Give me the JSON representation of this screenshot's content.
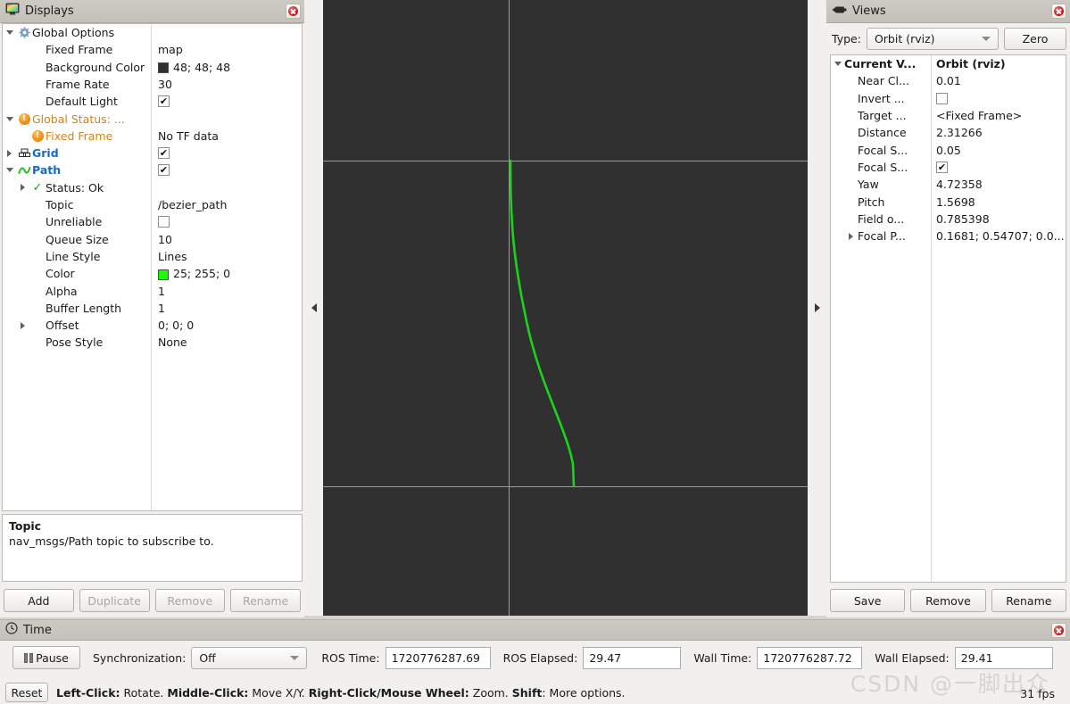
{
  "displays": {
    "title": "Displays",
    "icon": "monitor-icon",
    "close_icon": "close-icon",
    "tree": [
      {
        "indent": 0,
        "arrow": "down",
        "icon": "gear-icon",
        "label": "Global Options",
        "style": "plain",
        "value": "",
        "value_type": "none"
      },
      {
        "indent": 1,
        "arrow": "none",
        "icon": "none",
        "label": "Fixed Frame",
        "style": "plain",
        "value": "map",
        "value_type": "text"
      },
      {
        "indent": 1,
        "arrow": "none",
        "icon": "none",
        "label": "Background Color",
        "style": "plain",
        "value": "48; 48; 48",
        "value_type": "color",
        "color": "#303030"
      },
      {
        "indent": 1,
        "arrow": "none",
        "icon": "none",
        "label": "Frame Rate",
        "style": "plain",
        "value": "30",
        "value_type": "text"
      },
      {
        "indent": 1,
        "arrow": "none",
        "icon": "none",
        "label": "Default Light",
        "style": "plain",
        "value": "",
        "value_type": "checked"
      },
      {
        "indent": 0,
        "arrow": "down",
        "icon": "warning-icon",
        "label": "Global Status: ...",
        "style": "orange",
        "value": "",
        "value_type": "none"
      },
      {
        "indent": 1,
        "arrow": "none",
        "icon": "warning-icon",
        "label": "Fixed Frame",
        "style": "orange",
        "value": "No TF data",
        "value_type": "text"
      },
      {
        "indent": 0,
        "arrow": "right",
        "icon": "grid-icon",
        "label": "Grid",
        "style": "blue",
        "value": "",
        "value_type": "checked"
      },
      {
        "indent": 0,
        "arrow": "down",
        "icon": "path-icon",
        "label": "Path",
        "style": "blue",
        "value": "",
        "value_type": "checked"
      },
      {
        "indent": 1,
        "arrow": "right",
        "icon": "ok-icon",
        "label": "Status: Ok",
        "style": "plain",
        "value": "",
        "value_type": "none"
      },
      {
        "indent": 1,
        "arrow": "none",
        "icon": "none",
        "label": "Topic",
        "style": "plain",
        "value": "/bezier_path",
        "value_type": "text"
      },
      {
        "indent": 1,
        "arrow": "none",
        "icon": "none",
        "label": "Unreliable",
        "style": "plain",
        "value": "",
        "value_type": "unchecked"
      },
      {
        "indent": 1,
        "arrow": "none",
        "icon": "none",
        "label": "Queue Size",
        "style": "plain",
        "value": "10",
        "value_type": "text"
      },
      {
        "indent": 1,
        "arrow": "none",
        "icon": "none",
        "label": "Line Style",
        "style": "plain",
        "value": "Lines",
        "value_type": "text"
      },
      {
        "indent": 1,
        "arrow": "none",
        "icon": "none",
        "label": "Color",
        "style": "plain",
        "value": "25; 255; 0",
        "value_type": "color",
        "color": "#19ff00"
      },
      {
        "indent": 1,
        "arrow": "none",
        "icon": "none",
        "label": "Alpha",
        "style": "plain",
        "value": "1",
        "value_type": "text"
      },
      {
        "indent": 1,
        "arrow": "none",
        "icon": "none",
        "label": "Buffer Length",
        "style": "plain",
        "value": "1",
        "value_type": "text"
      },
      {
        "indent": 1,
        "arrow": "right",
        "icon": "none",
        "label": "Offset",
        "style": "plain",
        "value": "0; 0; 0",
        "value_type": "text"
      },
      {
        "indent": 1,
        "arrow": "none",
        "icon": "none",
        "label": "Pose Style",
        "style": "plain",
        "value": "None",
        "value_type": "text"
      }
    ],
    "help": {
      "title": "Topic",
      "body": "nav_msgs/Path topic to subscribe to."
    },
    "buttons": [
      {
        "label": "Add",
        "enabled": true
      },
      {
        "label": "Duplicate",
        "enabled": false
      },
      {
        "label": "Remove",
        "enabled": false
      },
      {
        "label": "Rename",
        "enabled": false
      }
    ]
  },
  "views": {
    "title": "Views",
    "icon": "camera-icon",
    "close_icon": "close-icon",
    "type_label": "Type:",
    "type_value": "Orbit (rviz)",
    "zero_label": "Zero",
    "tree": [
      {
        "indent": 0,
        "arrow": "down",
        "label": "Current V...",
        "bold": true,
        "value": "Orbit (rviz)",
        "value_type": "text",
        "value_bold": true
      },
      {
        "indent": 1,
        "arrow": "none",
        "label": "Near Cl...",
        "bold": false,
        "value": "0.01",
        "value_type": "text"
      },
      {
        "indent": 1,
        "arrow": "none",
        "label": "Invert ...",
        "bold": false,
        "value": "",
        "value_type": "unchecked"
      },
      {
        "indent": 1,
        "arrow": "none",
        "label": "Target ...",
        "bold": false,
        "value": "<Fixed Frame>",
        "value_type": "text"
      },
      {
        "indent": 1,
        "arrow": "none",
        "label": "Distance",
        "bold": false,
        "value": "2.31266",
        "value_type": "text"
      },
      {
        "indent": 1,
        "arrow": "none",
        "label": "Focal S...",
        "bold": false,
        "value": "0.05",
        "value_type": "text"
      },
      {
        "indent": 1,
        "arrow": "none",
        "label": "Focal S...",
        "bold": false,
        "value": "",
        "value_type": "checked"
      },
      {
        "indent": 1,
        "arrow": "none",
        "label": "Yaw",
        "bold": false,
        "value": "4.72358",
        "value_type": "text"
      },
      {
        "indent": 1,
        "arrow": "none",
        "label": "Pitch",
        "bold": false,
        "value": "1.5698",
        "value_type": "text"
      },
      {
        "indent": 1,
        "arrow": "none",
        "label": "Field o...",
        "bold": false,
        "value": "0.785398",
        "value_type": "text"
      },
      {
        "indent": 1,
        "arrow": "right",
        "label": "Focal P...",
        "bold": false,
        "value": "0.1681; 0.54707; 0.0...",
        "value_type": "text"
      }
    ],
    "buttons": [
      {
        "label": "Save",
        "enabled": true
      },
      {
        "label": "Remove",
        "enabled": true
      },
      {
        "label": "Rename",
        "enabled": true
      }
    ]
  },
  "render": {
    "background_color": "#303030",
    "grid_color": "#9b9b9b",
    "path_color": "#19d419"
  },
  "time": {
    "title": "Time",
    "icon": "clock-icon",
    "close_icon": "close-icon",
    "pause_label": "Pause",
    "sync_label": "Synchronization:",
    "sync_value": "Off",
    "ros_time_label": "ROS Time:",
    "ros_time_value": "1720776287.69",
    "ros_elapsed_label": "ROS Elapsed:",
    "ros_elapsed_value": "29.47",
    "wall_time_label": "Wall Time:",
    "wall_time_value": "1720776287.72",
    "wall_elapsed_label": "Wall Elapsed:",
    "wall_elapsed_value": "29.41"
  },
  "statusbar": {
    "reset_label": "Reset",
    "hint_parts": [
      {
        "text": "Left-Click:",
        "bold": true
      },
      {
        "text": " Rotate. ",
        "bold": false
      },
      {
        "text": "Middle-Click:",
        "bold": true
      },
      {
        "text": " Move X/Y. ",
        "bold": false
      },
      {
        "text": "Right-Click/Mouse Wheel:",
        "bold": true
      },
      {
        "text": " Zoom. ",
        "bold": false
      },
      {
        "text": "Shift",
        "bold": true
      },
      {
        "text": ": More options.",
        "bold": false
      }
    ],
    "fps": "31 fps",
    "watermark": "CSDN @一脚出众"
  }
}
